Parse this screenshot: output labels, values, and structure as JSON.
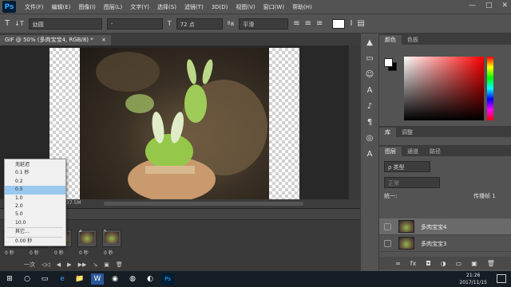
{
  "menubar": {
    "logo": "Ps",
    "items": [
      "文件(F)",
      "编辑(E)",
      "图像(I)",
      "图层(L)",
      "文字(Y)",
      "选择(S)",
      "滤镜(T)",
      "3D(D)",
      "视图(V)",
      "窗口(W)",
      "帮助(H)"
    ],
    "controls": [
      "—",
      "□",
      "✕"
    ]
  },
  "options": {
    "tool_glyph": "T",
    "orient_glyph": "↓T",
    "font_family": "幼圆",
    "font_style": "-",
    "size_glyph": "T",
    "font_size": "72 点",
    "aa_glyph": "ªa",
    "antialias": "平滑",
    "align_glyphs": [
      "≡",
      "≡",
      "≡"
    ],
    "warp_glyph": "Ⅰ",
    "panel_glyph": "▤",
    "text_color": "#ffffff"
  },
  "document": {
    "tab_title": "GIF @ 50% (多肉宝宝4, RGB/8) *",
    "close_glyph": "×",
    "status_text": "6M/37.5M"
  },
  "timeline": {
    "frames": [
      {
        "num": "1",
        "delay": "0 秒"
      },
      {
        "num": "2",
        "delay": "0 秒"
      },
      {
        "num": "3",
        "delay": "0 秒"
      },
      {
        "num": "4",
        "delay": "0 秒"
      },
      {
        "num": "5",
        "delay": "0 秒"
      }
    ],
    "loop": "一次",
    "controls": [
      "◁◁",
      "◀",
      "▶",
      "▶▶",
      "↘",
      "▣",
      "🗑"
    ],
    "selected_delay": "0 秒",
    "visible_delays": [
      "0 秒",
      "0 秒",
      "0 秒",
      "0 秒",
      "0 秒"
    ]
  },
  "delay_menu": {
    "items": [
      "无延迟",
      "0.1 秒",
      "0.2",
      "0.5",
      "1.0",
      "2.0",
      "5.0",
      "10.0",
      "其它...",
      "0.00 秒"
    ],
    "selected_index": 3
  },
  "tools": [
    "▲",
    "▭",
    "☺",
    "A",
    "♪",
    "¶",
    "◎",
    "A"
  ],
  "color_panel": {
    "tabs": [
      "颜色",
      "色板"
    ],
    "fg": "#ffffff",
    "bg": "#000000"
  },
  "library_panel": {
    "tabs": [
      "库",
      "调整"
    ]
  },
  "layers_panel": {
    "tabs": [
      "图层",
      "通道",
      "路径"
    ],
    "filter_label": "ρ 类型",
    "mode": "正常",
    "unify_label": "统一:",
    "propagate_label": "传播帧 1",
    "layers": [
      {
        "name": "多肉宝宝4",
        "selected": true
      },
      {
        "name": "多肉宝宝3",
        "selected": false
      }
    ],
    "bottom_icons": [
      "∞",
      "fx",
      "◘",
      "◑",
      "▭",
      "▣",
      "🗑"
    ]
  },
  "taskbar": {
    "time": "21:26",
    "date": "2017/11/15",
    "apps": [
      "⊞",
      "○",
      "▭",
      "e",
      "📁",
      "W",
      "◉",
      "◍",
      "◐",
      "Ps"
    ]
  }
}
